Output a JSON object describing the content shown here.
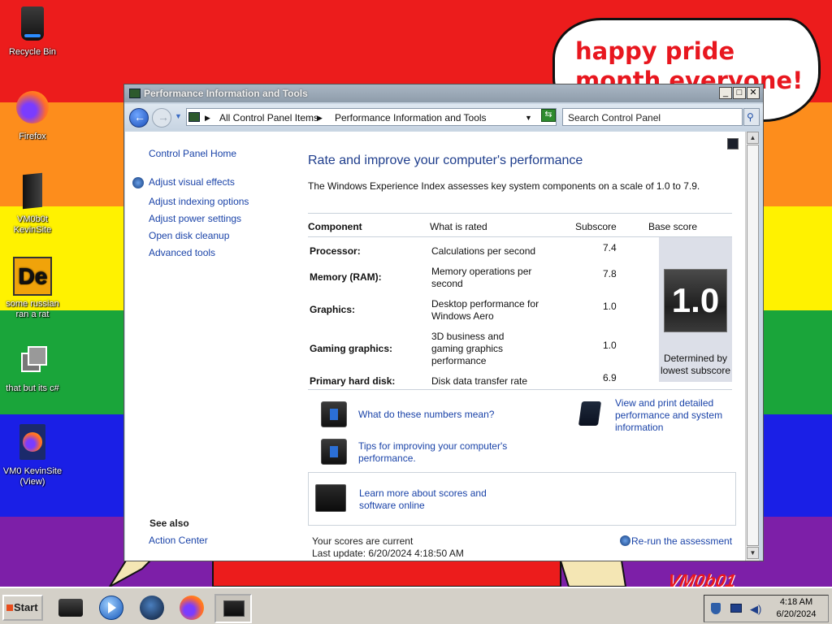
{
  "desktop": {
    "bubble_text": "happy pride month everyone!",
    "signature": "VM0b01",
    "icons": [
      {
        "label": "Recycle Bin"
      },
      {
        "label": "Firefox"
      },
      {
        "label": "VM0b0t KevinSite"
      },
      {
        "label": "some russian ran a rat"
      },
      {
        "label": "that but its c#"
      },
      {
        "label": "VM0 KevinSite (View)"
      }
    ]
  },
  "window": {
    "title": "Performance Information and Tools",
    "address": {
      "segments": [
        "All Control Panel Items",
        "Performance Information and Tools"
      ]
    },
    "search": {
      "placeholder": "Search Control Panel"
    },
    "sidebar": {
      "home": "Control Panel Home",
      "items": [
        {
          "label": "Adjust visual effects"
        },
        {
          "label": "Adjust indexing options"
        },
        {
          "label": "Adjust power settings"
        },
        {
          "label": "Open disk cleanup"
        },
        {
          "label": "Advanced tools"
        }
      ],
      "see_also_heading": "See also",
      "see_also": [
        {
          "label": "Action Center"
        }
      ]
    },
    "main": {
      "title": "Rate and improve your computer's performance",
      "description": "The Windows Experience Index assesses key system components on a scale of 1.0 to 7.9.",
      "columns": [
        "Component",
        "What is rated",
        "Subscore",
        "Base score"
      ],
      "rows": [
        {
          "component": "Processor:",
          "rated": "Calculations per second",
          "subscore": "7.4"
        },
        {
          "component": "Memory (RAM):",
          "rated": "Memory operations per second",
          "subscore": "7.8"
        },
        {
          "component": "Graphics:",
          "rated": "Desktop performance for Windows Aero",
          "subscore": "1.0"
        },
        {
          "component": "Gaming graphics:",
          "rated": "3D business and gaming graphics performance",
          "subscore": "1.0"
        },
        {
          "component": "Primary hard disk:",
          "rated": "Disk data transfer rate",
          "subscore": "6.9"
        }
      ],
      "base_score": "1.0",
      "base_score_note": "Determined by lowest subscore",
      "links": {
        "what_numbers": "What do these numbers mean?",
        "tips": "Tips for improving your computer's performance.",
        "view_print": "View and print detailed performance and system information",
        "learn_more": "Learn more about scores and software online"
      },
      "status": "Your scores are current",
      "last_update": "Last update: 6/20/2024 4:18:50 AM",
      "rerun": "Re-run the assessment"
    }
  },
  "taskbar": {
    "start_label": "Start",
    "time": "4:18 AM",
    "date": "6/20/2024"
  }
}
